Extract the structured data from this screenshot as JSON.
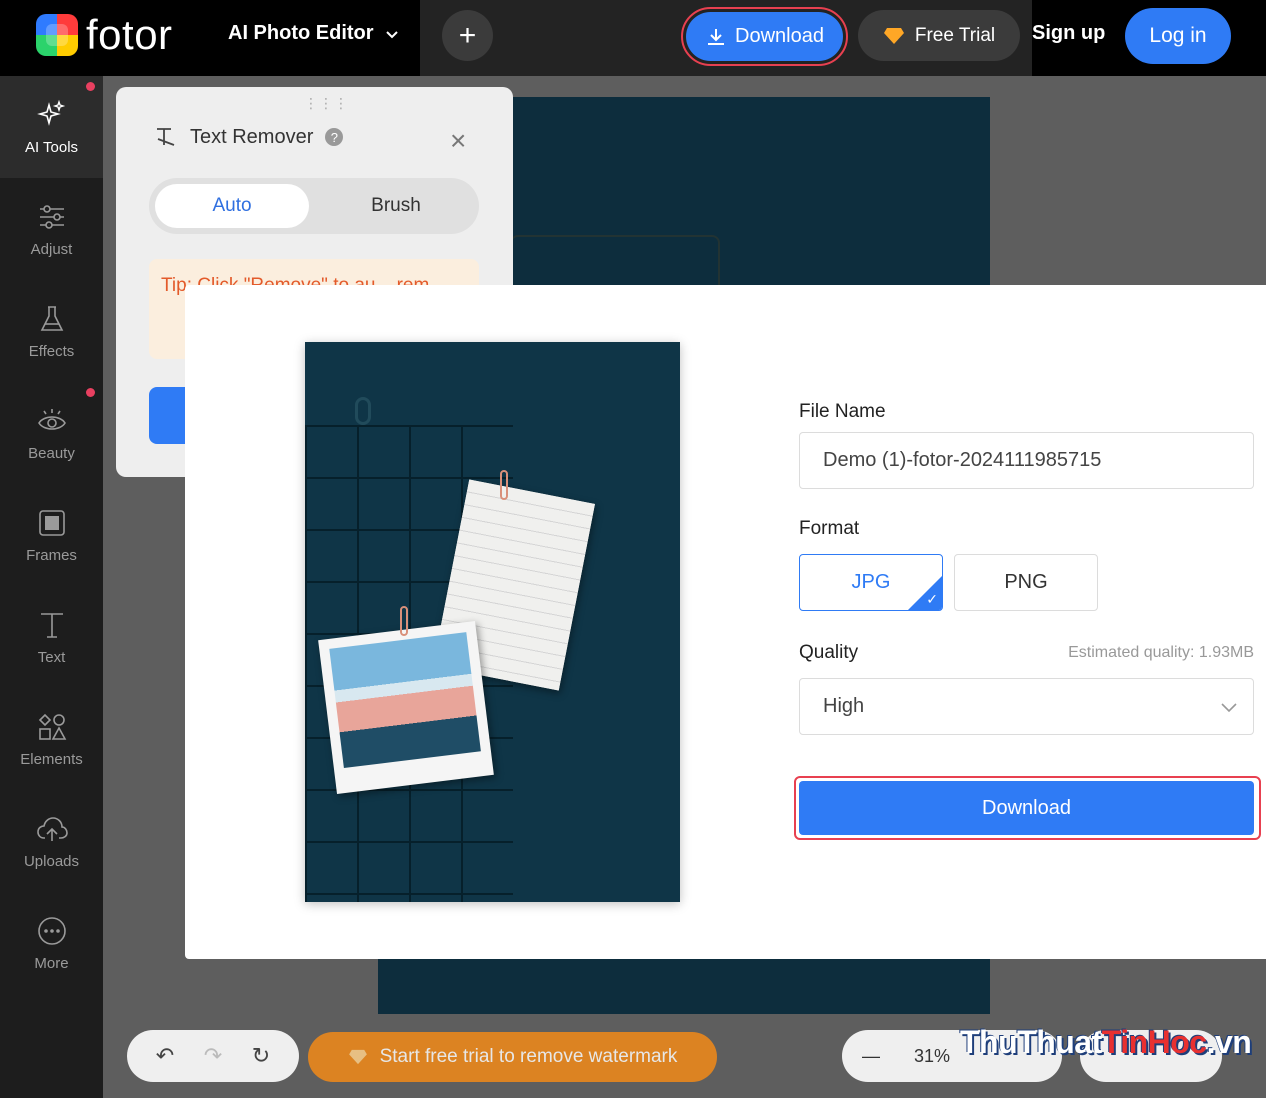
{
  "header": {
    "logo_text": "fotor",
    "editor_menu_label": "AI Photo Editor",
    "add_label": "+",
    "download_label": "Download",
    "free_trial_label": "Free Trial",
    "signup_label": "Sign up",
    "login_label": "Log in"
  },
  "sidebar": {
    "items": [
      {
        "label": "AI Tools",
        "icon": "sparkle-icon"
      },
      {
        "label": "Adjust",
        "icon": "sliders-icon"
      },
      {
        "label": "Effects",
        "icon": "flask-icon"
      },
      {
        "label": "Beauty",
        "icon": "eye-icon"
      },
      {
        "label": "Frames",
        "icon": "frame-icon"
      },
      {
        "label": "Text",
        "icon": "text-icon"
      },
      {
        "label": "Elements",
        "icon": "shapes-icon"
      },
      {
        "label": "Uploads",
        "icon": "cloud-upload-icon"
      },
      {
        "label": "More",
        "icon": "more-icon"
      }
    ]
  },
  "text_remover": {
    "drag_handle": "⋮⋮⋮",
    "title": "Text Remover",
    "help": "?",
    "close": "×",
    "tab_auto": "Auto",
    "tab_brush": "Brush",
    "tip_text": "Tip: Click \"Remove\" to au... rem..."
  },
  "download_dialog": {
    "file_name_label": "File Name",
    "file_name_value": "Demo (1)-fotor-2024111985715",
    "format_label": "Format",
    "format_options": [
      "JPG",
      "PNG"
    ],
    "format_selected": "JPG",
    "quality_label": "Quality",
    "estimated_quality": "Estimated quality: 1.93MB",
    "quality_value": "High",
    "download_label": "Download"
  },
  "bottom_bar": {
    "undo": "↶",
    "redo": "↷",
    "reset": "↻",
    "trial_label": "Start free trial to remove watermark",
    "zoom_minus": "—",
    "zoom_value": "31%"
  },
  "watermark": {
    "part1": "ThuThuat",
    "part2": "TinHoc",
    "part3": ".vn"
  },
  "colors": {
    "accent": "#2f7bf5",
    "highlight": "#e84050",
    "trial": "#f28a18"
  }
}
